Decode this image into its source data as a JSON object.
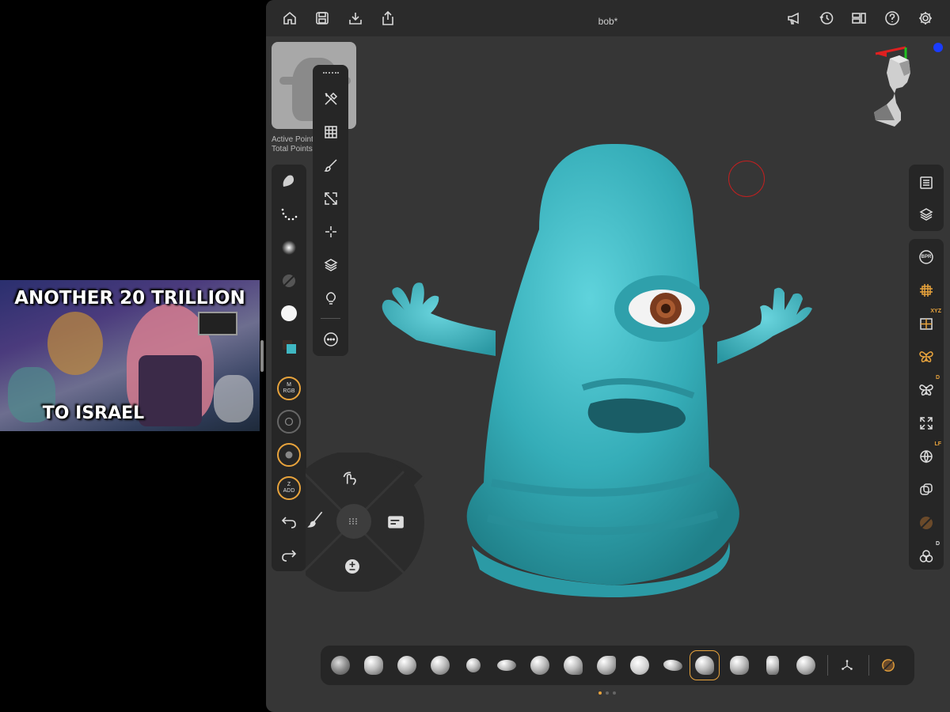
{
  "video": {
    "caption_top": "ANOTHER 20 TRILLION",
    "caption_bottom": "TO ISRAEL"
  },
  "topbar": {
    "title": "bob*",
    "left_icons": [
      "home-icon",
      "save-icon",
      "import-icon",
      "share-icon"
    ],
    "right_icons": [
      "megaphone-icon",
      "history-icon",
      "layout-icon",
      "help-icon",
      "settings-icon"
    ]
  },
  "object_panel": {
    "active_points_label": "Active Point",
    "total_points_label": "Total Points"
  },
  "tool_palette": {
    "items": [
      "tools-icon",
      "checker-icon",
      "brush-icon",
      "transform-icon",
      "crosshair-icon",
      "layers-icon",
      "light-icon",
      "more-icon"
    ]
  },
  "sculpt_strip": {
    "items": [
      "brush-preview",
      "stroke-icon",
      "falloff-icon",
      "alpha-icon",
      "material-icon",
      "color-icon"
    ],
    "rgb_ring": {
      "top": "M",
      "bottom": "RGB"
    },
    "z_ring": {
      "top": "Z",
      "bottom": "ADD"
    },
    "undo": "undo-icon",
    "redo": "redo-icon"
  },
  "pie_menu": {
    "top": "gesture-icon",
    "left": "paint-icon",
    "right": "panel-icon",
    "bottom": "plus-minus-icon",
    "center": "grid-icon"
  },
  "right_panel": {
    "top_items": [
      "list-icon",
      "layers-icon"
    ],
    "items": [
      {
        "icon": "bpr-icon",
        "badge": "BPR"
      },
      {
        "icon": "frame-icon",
        "badge": ""
      },
      {
        "icon": "symmetry-axis-icon",
        "badge": "XYZ"
      },
      {
        "icon": "butterfly-icon",
        "badge": ""
      },
      {
        "icon": "butterfly-d-icon",
        "badge": "D"
      },
      {
        "icon": "fit-icon",
        "badge": ""
      },
      {
        "icon": "globe-icon",
        "badge": "LF"
      },
      {
        "icon": "boolean-icon",
        "badge": ""
      },
      {
        "icon": "matcap-icon",
        "badge": ""
      },
      {
        "icon": "circles-icon",
        "badge": "D"
      }
    ]
  },
  "brush_bar": {
    "count": 15,
    "selected_index": 11,
    "pages": 3,
    "active_page": 0
  },
  "colors": {
    "accent": "#e8a33c",
    "model": "#3fb7c2",
    "viewport": "#363636"
  }
}
